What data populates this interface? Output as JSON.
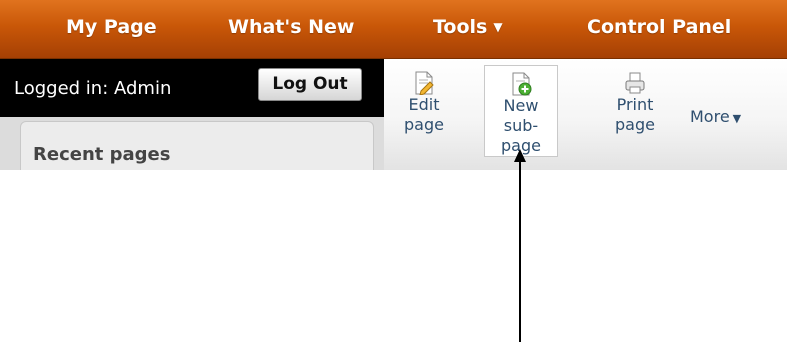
{
  "nav": {
    "items": [
      {
        "label": "My Page"
      },
      {
        "label": "What's New"
      },
      {
        "label": "Tools",
        "caret": "▼"
      },
      {
        "label": "Control Panel"
      }
    ]
  },
  "login": {
    "status": "Logged in: Admin",
    "logout_label": "Log Out"
  },
  "sidebar": {
    "recent_title": "Recent pages"
  },
  "toolbar": {
    "edit": {
      "line1": "Edit",
      "line2": "page",
      "icon": "edit-page-icon"
    },
    "new_sub": {
      "line1": "New",
      "line2": "sub-page",
      "icon": "new-subpage-icon"
    },
    "print": {
      "line1": "Print",
      "line2": "page",
      "icon": "printer-icon"
    },
    "more": {
      "label": "More",
      "caret": "▼"
    }
  },
  "colors": {
    "nav_top": "#e0731e",
    "nav_bottom": "#a54004",
    "link_text": "#2f4f6f"
  }
}
